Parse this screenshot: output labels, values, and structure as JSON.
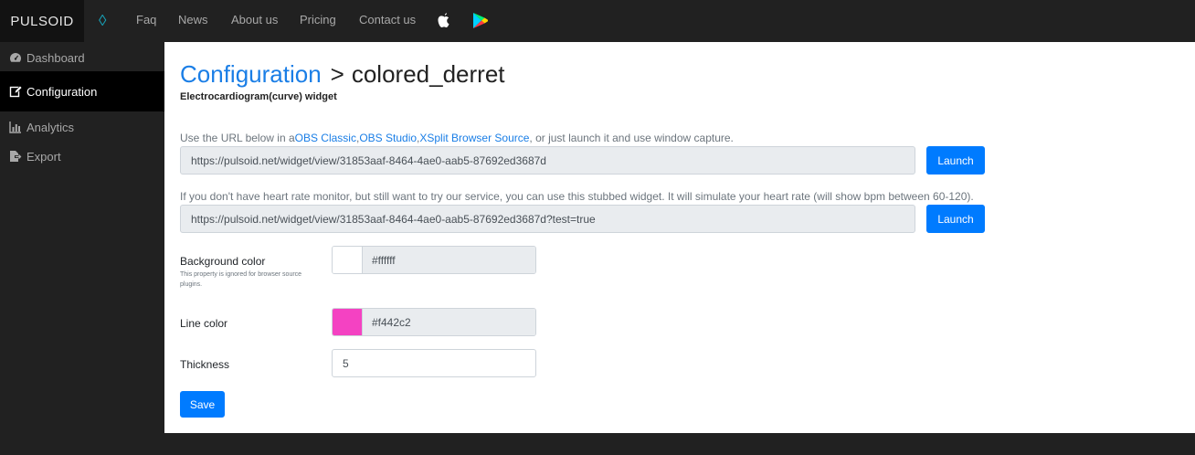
{
  "brand": "PULSOID",
  "nav": {
    "links": [
      "Faq",
      "News",
      "About us",
      "Pricing",
      "Contact us"
    ],
    "diamond_glyph": "◊",
    "icons": [
      "apple-icon",
      "google-play-icon"
    ]
  },
  "sidebar": {
    "items": [
      {
        "label": "Dashboard",
        "icon": "dashboard-gauge-icon"
      },
      {
        "label": "Configuration",
        "icon": "edit-icon",
        "active": true
      },
      {
        "label": "Analytics",
        "icon": "bar-chart-icon"
      },
      {
        "label": "Export",
        "icon": "export-icon"
      }
    ]
  },
  "page": {
    "breadcrumb": "Configuration",
    "separator": ">",
    "widget_name": "colored_derret",
    "subtitle": "Electrocardiogram(curve) widget"
  },
  "url_section": {
    "help_prefix": "Use the URL below in a",
    "link1": "OBS Classic",
    "comma1": ",",
    "link2": "OBS Studio",
    "comma2": ",",
    "link3": "XSplit Browser Source",
    "help_suffix": ", or just launch it and use window capture.",
    "url": "https://pulsoid.net/widget/view/31853aaf-8464-4ae0-aab5-87692ed3687d",
    "launch_label": "Launch"
  },
  "test_section": {
    "help": "If you don't have heart rate monitor, but still want to try our service, you can use this stubbed widget. It will simulate your heart rate (will show bpm between 60-120).",
    "url": "https://pulsoid.net/widget/view/31853aaf-8464-4ae0-aab5-87692ed3687d?test=true",
    "launch_label": "Launch"
  },
  "form": {
    "background_color": {
      "label": "Background color",
      "note": "This property is ignored for browser source plugins.",
      "value": "#ffffff"
    },
    "line_color": {
      "label": "Line color",
      "value": "#f442c2"
    },
    "thickness": {
      "label": "Thickness",
      "value": "5"
    },
    "save_label": "Save"
  },
  "colors": {
    "accent": "#007bff",
    "link": "#1a7ee6",
    "background_swatch": "#ffffff",
    "line_swatch": "#f442c2",
    "sidebar_bg": "#212121"
  }
}
